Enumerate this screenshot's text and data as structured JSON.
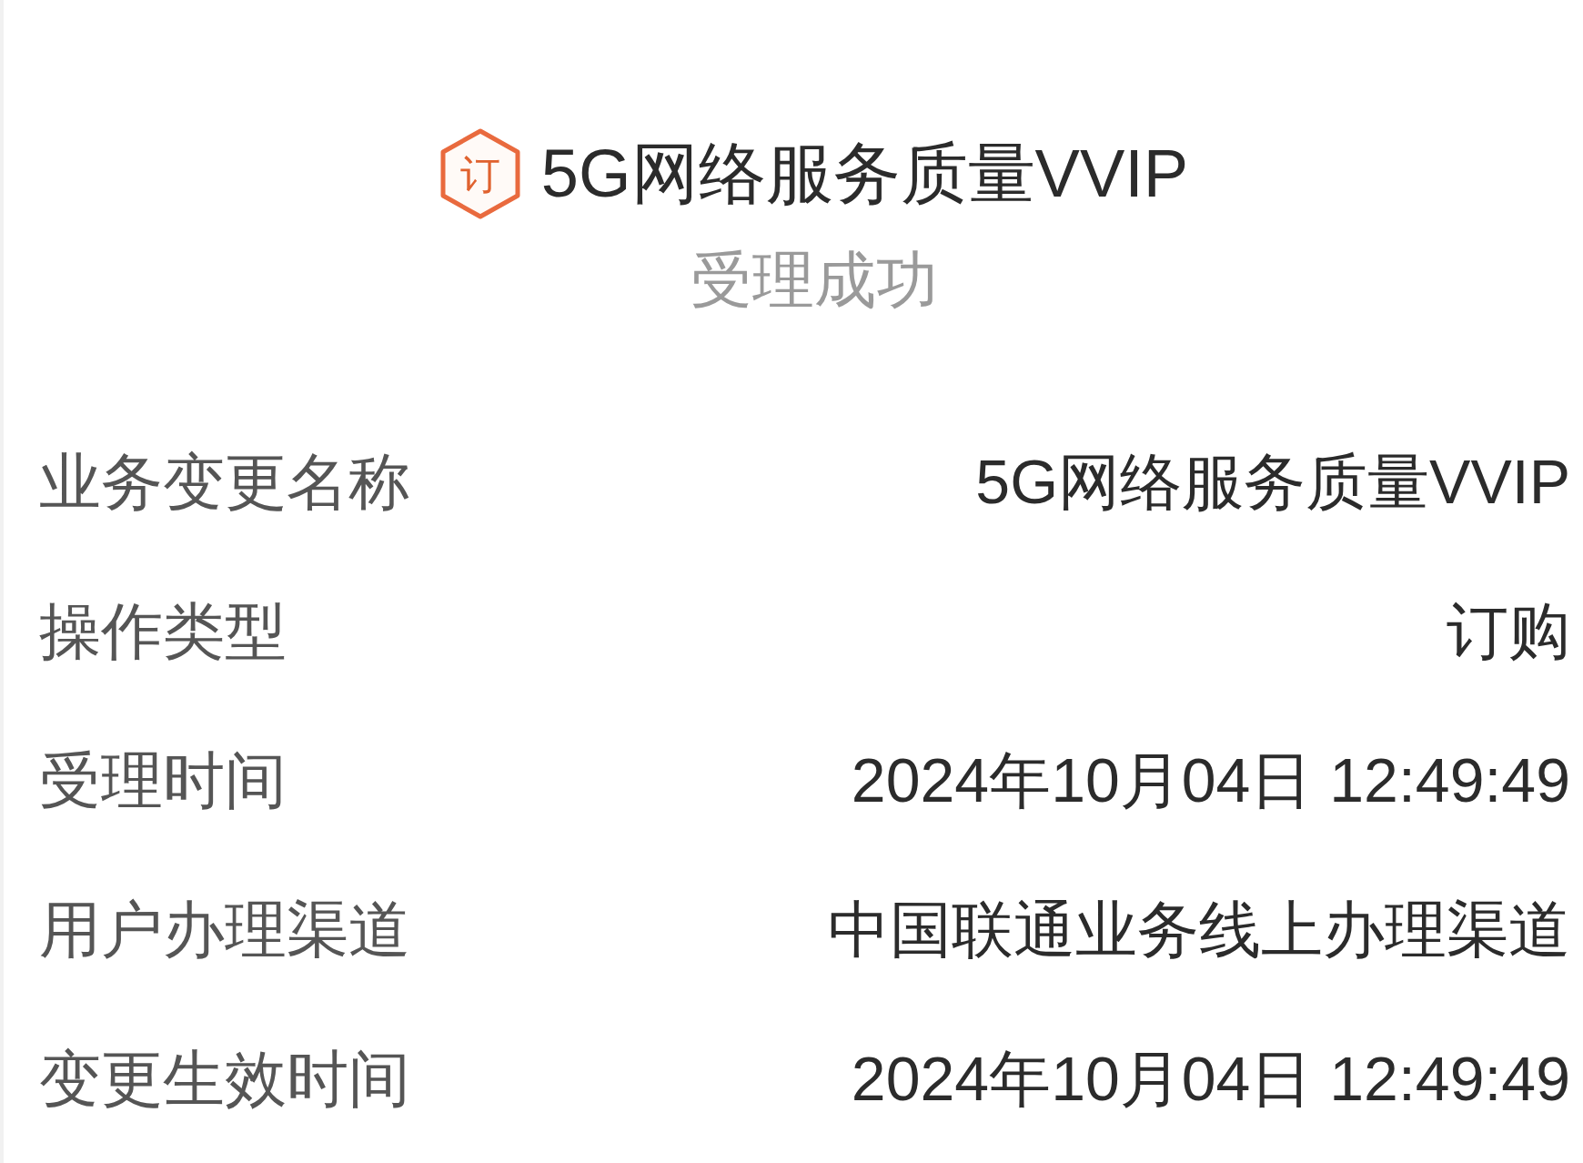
{
  "header": {
    "badge": "订",
    "title": "5G网络服务质量VVIP",
    "status": "受理成功"
  },
  "details": [
    {
      "label": "业务变更名称",
      "value": "5G网络服务质量VVIP"
    },
    {
      "label": "操作类型",
      "value": "订购"
    },
    {
      "label": "受理时间",
      "value": "2024年10月04日 12:49:49"
    },
    {
      "label": "用户办理渠道",
      "value": "中国联通业务线上办理渠道"
    },
    {
      "label": "变更生效时间",
      "value": "2024年10月04日 12:49:49"
    }
  ]
}
